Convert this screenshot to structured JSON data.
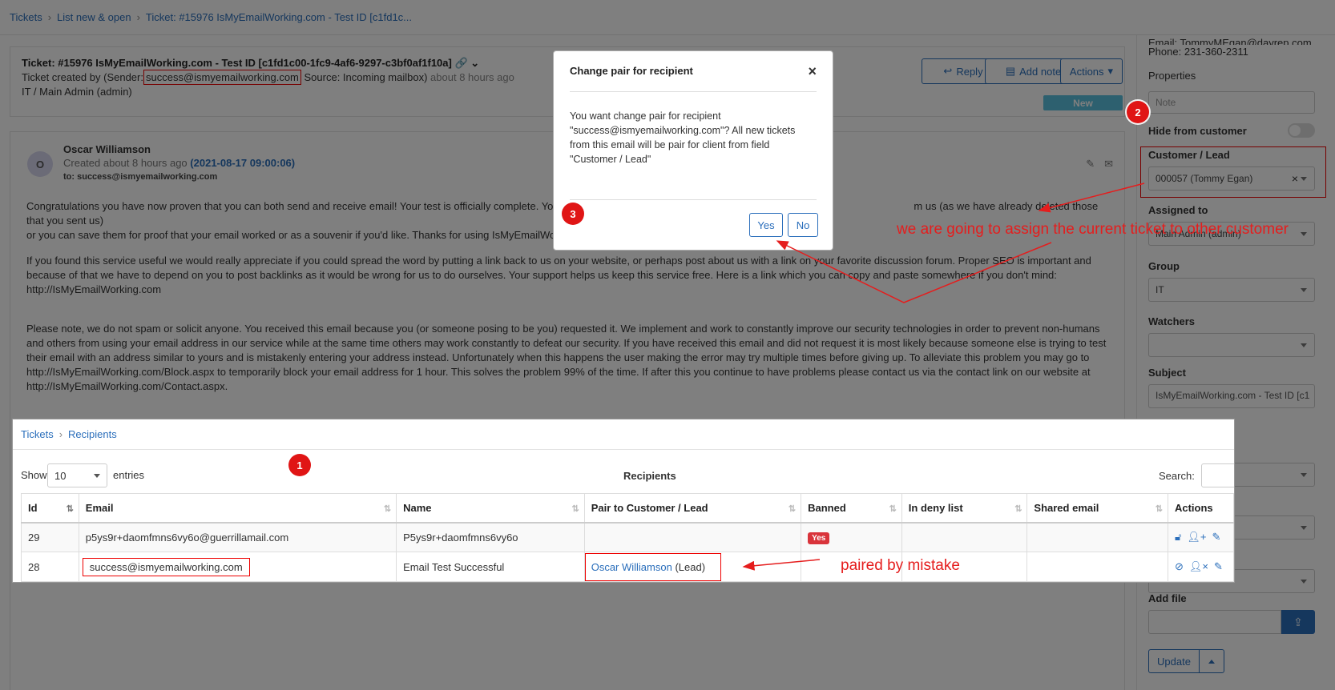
{
  "breadcrumb": [
    "Tickets",
    "List new & open",
    "Ticket: #15976 IsMyEmailWorking.com - Test ID [c1fd1c..."
  ],
  "ticket": {
    "title": "Ticket: #15976 IsMyEmailWorking.com - Test ID [c1fd1c00-1fc9-4af6-9297-c3bf0af1f10a]",
    "meta_prefix": "Ticket created by (Sender:",
    "sender_email": "success@ismyemailworking.com",
    "meta_source": "Source: Incoming mailbox)",
    "meta_ago": "about 8 hours ago",
    "owner": "IT / Main Admin (admin)",
    "reply_label": "Reply",
    "add_note_label": "Add note",
    "actions_label": "Actions",
    "status": "New"
  },
  "message": {
    "avatar_letter": "O",
    "sender": "Oscar Williamson",
    "created_prefix": "Created about 8 hours ago",
    "created_date": "(2021-08-17 09:00:06)",
    "to": "to: success@ismyemailworking.com",
    "p1a": "Congratulations you have now proven that you can both send and receive email! Your test is officially complete. Yo",
    "p1a_tail": "m us (as we have already deleted those that you sent us)",
    "p1b": "or you can save them for proof that your email worked or as a souvenir if you'd like. Thanks for using IsMyEmailWo",
    "p2a": "If you found this service useful we would really appreciate if you could spread the word by putting a link back to us on your website, or perhaps post about us with a link on your favorite discussion forum. Proper SEO is important and",
    "p2b": "because of that we have to depend on you to post backlinks as it would be wrong for us to do ourselves. Your support helps us keep this service free. Here is a link which you can copy and paste somewhere if you don't mind:",
    "p2c": "http://IsMyEmailWorking.com",
    "p3a": "Please note, we do not spam or solicit anyone. You received this email because you (or someone posing to be you) requested it. We implement and work to constantly improve our security technologies in order to prevent non-humans",
    "p3b": "and others from using your email address in our service while at the same time others may work constantly to defeat our security. If you have received this email and did not request it is most likely because someone else is trying to test",
    "p3c": "their email with an address similar to yours and is mistakenly entering your address instead. Unfortunately when this happens the user making the error may try multiple times before giving up. To alleviate this problem you may go to",
    "p3d": "http://IsMyEmailWorking.com/Block.aspx to temporarily block your email address for 1 hour. This solves the problem 99% of the time. If after this you continue to have problems please contact us via the contact link on our website at",
    "p3e": "http://IsMyEmailWorking.com/Contact.aspx."
  },
  "sidebar": {
    "email_line": "Email: TommyMEgan@dayrep.com",
    "phone_line": "Phone: 231-360-2311",
    "properties_label": "Properties",
    "note_placeholder": "Note",
    "hide_label": "Hide from customer",
    "customer_label": "Customer / Lead",
    "customer_value": "000057 (Tommy Egan)",
    "assigned_label": "Assigned to",
    "assigned_value": "Main Admin (admin)",
    "group_label": "Group",
    "group_value": "IT",
    "watchers_label": "Watchers",
    "subject_label": "Subject",
    "subject_value": "IsMyEmailWorking.com - Test ID [c1",
    "add_file_label": "Add file",
    "update_label": "Update"
  },
  "modal": {
    "title": "Change pair for recipient",
    "body": "You want change pair for recipient \"success@ismyemailworking.com\"? All new tickets from this email will be pair for client from field \"Customer / Lead\"",
    "yes_label": "Yes",
    "no_label": "No"
  },
  "recipients": {
    "breadcrumb": [
      "Tickets",
      "Recipients"
    ],
    "show_label": "Show",
    "show_value": "10",
    "entries_label": "entries",
    "title": "Recipients",
    "search_label": "Search:",
    "columns": [
      "Id",
      "Email",
      "Name",
      "Pair to Customer / Lead",
      "Banned",
      "In deny list",
      "Shared email",
      "Actions"
    ],
    "rows": [
      {
        "id": "29",
        "email": "p5ys9r+daomfmns6vy6o@guerrillamail.com",
        "name": "P5ys9r+daomfmns6vy6o",
        "pair_name": "",
        "pair_suffix": "",
        "banned": "Yes"
      },
      {
        "id": "28",
        "email": "success@ismyemailworking.com",
        "name": "Email Test Successful",
        "pair_name": "Oscar Williamson",
        "pair_suffix": "(Lead)",
        "banned": ""
      }
    ]
  },
  "annotations": {
    "step1": "1",
    "step2": "2",
    "step3": "3",
    "assign_note": "we are going to assign the current ticket to other customer",
    "mistake_note": "paired by mistake",
    "color": "#e51d1d"
  }
}
